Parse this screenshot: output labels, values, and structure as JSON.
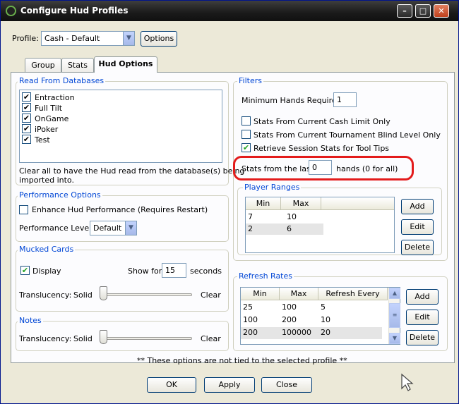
{
  "window": {
    "title": "Configure Hud Profiles",
    "buttons": {
      "minimize": "–",
      "maximize": "□",
      "close": "✕"
    }
  },
  "profile": {
    "label": "Profile:",
    "value": "Cash - Default",
    "options_button": "Options"
  },
  "tabs": [
    {
      "label": "Group",
      "active": false
    },
    {
      "label": "Stats",
      "active": false
    },
    {
      "label": "Hud Options",
      "active": true
    }
  ],
  "read_from_databases": {
    "title": "Read From Databases",
    "databases": [
      {
        "name": "Entraction",
        "checked": true
      },
      {
        "name": "Full Tilt",
        "checked": true
      },
      {
        "name": "OnGame",
        "checked": true
      },
      {
        "name": "iPoker",
        "checked": true
      },
      {
        "name": "Test",
        "checked": true
      }
    ],
    "note_line1": "Clear all to have the Hud read from the database(s) being",
    "note_line2": "imported into."
  },
  "performance": {
    "title": "Performance Options",
    "enhance_label": "Enhance Hud Performance (Requires Restart)",
    "enhance_checked": false,
    "level_label": "Performance Level:",
    "level_value": "Default"
  },
  "mucked_cards": {
    "title": "Mucked Cards",
    "display_label": "Display",
    "display_checked": true,
    "show_for_label": "Show for",
    "show_for_value": "15",
    "seconds_label": "seconds",
    "translucency_label": "Translucency:",
    "solid_label": "Solid",
    "clear_label": "Clear",
    "translucency_level": 0
  },
  "notes": {
    "title": "Notes",
    "translucency_label": "Translucency:",
    "solid_label": "Solid",
    "clear_label": "Clear",
    "translucency_level": 0
  },
  "filters": {
    "title": "Filters",
    "min_hands_label": "Minimum Hands Required:",
    "min_hands_value": "1",
    "options": [
      {
        "label": "Stats From Current Cash Limit Only",
        "checked": false
      },
      {
        "label": "Stats From Current Tournament Blind Level Only",
        "checked": false
      },
      {
        "label": "Retrieve Session Stats for Tool Tips",
        "checked": true
      }
    ],
    "stats_last_label": "Stats from the last",
    "stats_last_value": "0",
    "stats_last_suffix": "hands (0 for all)"
  },
  "player_ranges": {
    "title": "Player Ranges",
    "columns": [
      "Min",
      "Max"
    ],
    "rows": [
      [
        "7",
        "10"
      ],
      [
        "2",
        "6"
      ]
    ],
    "selected_row": 1,
    "add": "Add",
    "edit": "Edit",
    "delete": "Delete"
  },
  "refresh_rates": {
    "title": "Refresh Rates",
    "columns": [
      "Min",
      "Max",
      "Refresh Every"
    ],
    "rows": [
      [
        "25",
        "100",
        "5"
      ],
      [
        "100",
        "200",
        "10"
      ],
      [
        "200",
        "100000",
        "20"
      ]
    ],
    "selected_row": 2,
    "add": "Add",
    "edit": "Edit",
    "delete": "Delete"
  },
  "footer": {
    "note": "** These options are not tied to the selected profile **",
    "ok": "OK",
    "apply": "Apply",
    "close": "Close"
  },
  "colors": {
    "group_title": "#0046d5",
    "highlight_ring": "#e31b1b",
    "checkmark": "#21a121"
  }
}
